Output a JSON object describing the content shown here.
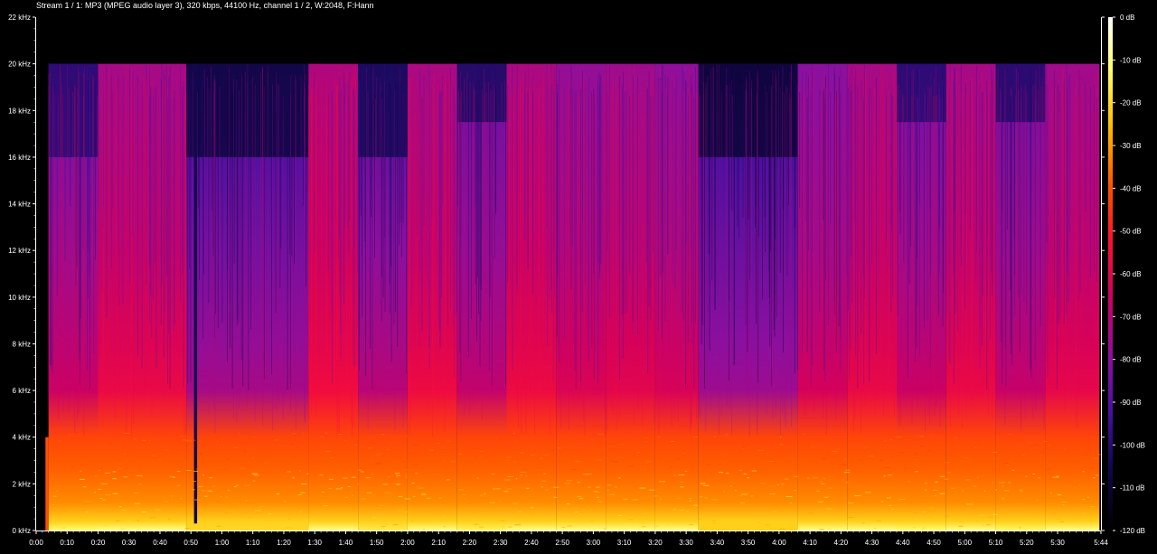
{
  "chart_data": {
    "type": "heatmap",
    "title": "Stream 1 / 1: MP3 (MPEG audio layer 3), 320 kbps, 44100 Hz, channel 1 / 2, W:2048, F:Hann",
    "xlabel": "",
    "ylabel": "",
    "x_unit": "seconds",
    "xlim": [
      0,
      344
    ],
    "ylim_khz": [
      0,
      22
    ],
    "x_ticks": [
      {
        "value": 0,
        "label": "0:00"
      },
      {
        "value": 10,
        "label": "0:10"
      },
      {
        "value": 20,
        "label": "0:20"
      },
      {
        "value": 30,
        "label": "0:30"
      },
      {
        "value": 40,
        "label": "0:40"
      },
      {
        "value": 50,
        "label": "0:50"
      },
      {
        "value": 60,
        "label": "1:00"
      },
      {
        "value": 70,
        "label": "1:10"
      },
      {
        "value": 80,
        "label": "1:20"
      },
      {
        "value": 90,
        "label": "1:30"
      },
      {
        "value": 100,
        "label": "1:40"
      },
      {
        "value": 110,
        "label": "1:50"
      },
      {
        "value": 120,
        "label": "2:00"
      },
      {
        "value": 130,
        "label": "2:10"
      },
      {
        "value": 140,
        "label": "2:20"
      },
      {
        "value": 150,
        "label": "2:30"
      },
      {
        "value": 160,
        "label": "2:40"
      },
      {
        "value": 170,
        "label": "2:50"
      },
      {
        "value": 180,
        "label": "3:00"
      },
      {
        "value": 190,
        "label": "3:10"
      },
      {
        "value": 200,
        "label": "3:20"
      },
      {
        "value": 210,
        "label": "3:30"
      },
      {
        "value": 220,
        "label": "3:40"
      },
      {
        "value": 230,
        "label": "3:50"
      },
      {
        "value": 240,
        "label": "4:00"
      },
      {
        "value": 250,
        "label": "4:10"
      },
      {
        "value": 260,
        "label": "4:20"
      },
      {
        "value": 270,
        "label": "4:30"
      },
      {
        "value": 280,
        "label": "4:40"
      },
      {
        "value": 290,
        "label": "4:50"
      },
      {
        "value": 300,
        "label": "5:00"
      },
      {
        "value": 310,
        "label": "5:10"
      },
      {
        "value": 320,
        "label": "5:20"
      },
      {
        "value": 330,
        "label": "5:30"
      },
      {
        "value": 344,
        "label": "5:44"
      }
    ],
    "y_ticks": [
      {
        "value": 0,
        "label": "0 kHz"
      },
      {
        "value": 2,
        "label": "2 kHz"
      },
      {
        "value": 4,
        "label": "4 kHz"
      },
      {
        "value": 6,
        "label": "6 kHz"
      },
      {
        "value": 8,
        "label": "8 kHz"
      },
      {
        "value": 10,
        "label": "10 kHz"
      },
      {
        "value": 12,
        "label": "12 kHz"
      },
      {
        "value": 14,
        "label": "14 kHz"
      },
      {
        "value": 16,
        "label": "16 kHz"
      },
      {
        "value": 18,
        "label": "18 kHz"
      },
      {
        "value": 20,
        "label": "20 kHz"
      },
      {
        "value": 22,
        "label": "22 kHz"
      }
    ],
    "colorbar": {
      "range_db": [
        -120,
        0
      ],
      "ticks": [
        {
          "value": 0,
          "label": "0 dB"
        },
        {
          "value": -10,
          "label": "-10 dB"
        },
        {
          "value": -20,
          "label": "-20 dB"
        },
        {
          "value": -30,
          "label": "-30 dB"
        },
        {
          "value": -40,
          "label": "-40 dB"
        },
        {
          "value": -50,
          "label": "-50 dB"
        },
        {
          "value": -60,
          "label": "-60 dB"
        },
        {
          "value": -70,
          "label": "-70 dB"
        },
        {
          "value": -80,
          "label": "-80 dB"
        },
        {
          "value": -90,
          "label": "-90 dB"
        },
        {
          "value": -100,
          "label": "-100 dB"
        },
        {
          "value": -110,
          "label": "-110 dB"
        },
        {
          "value": -120,
          "label": "-120 dB"
        }
      ],
      "stops": [
        {
          "db": 0,
          "color": "#ffffff"
        },
        {
          "db": -12,
          "color": "#ffff70"
        },
        {
          "db": -25,
          "color": "#ffc000"
        },
        {
          "db": -40,
          "color": "#ff5000"
        },
        {
          "db": -52,
          "color": "#ff1030"
        },
        {
          "db": -65,
          "color": "#d00060"
        },
        {
          "db": -80,
          "color": "#8a10a0"
        },
        {
          "db": -92,
          "color": "#4a10a0"
        },
        {
          "db": -105,
          "color": "#100850"
        },
        {
          "db": -120,
          "color": "#000000"
        }
      ]
    },
    "lowpass_cutoff_khz": 20,
    "segments": [
      {
        "start": 4,
        "end": 20,
        "level_db": -72,
        "upper_cutoff_khz": 16
      },
      {
        "start": 20,
        "end": 48.5,
        "level_db": -64,
        "upper_cutoff_khz": 20
      },
      {
        "start": 48.5,
        "end": 88,
        "level_db": -80,
        "upper_cutoff_khz": 16
      },
      {
        "start": 88,
        "end": 104,
        "level_db": -62,
        "upper_cutoff_khz": 20
      },
      {
        "start": 104,
        "end": 120,
        "level_db": -76,
        "upper_cutoff_khz": 16
      },
      {
        "start": 120,
        "end": 136,
        "level_db": -63,
        "upper_cutoff_khz": 20
      },
      {
        "start": 136,
        "end": 152,
        "level_db": -74,
        "upper_cutoff_khz": 17.5
      },
      {
        "start": 152,
        "end": 168,
        "level_db": -63,
        "upper_cutoff_khz": 20
      },
      {
        "start": 168,
        "end": 184,
        "level_db": -68,
        "upper_cutoff_khz": 20
      },
      {
        "start": 184,
        "end": 200,
        "level_db": -66,
        "upper_cutoff_khz": 20
      },
      {
        "start": 200,
        "end": 214,
        "level_db": -69,
        "upper_cutoff_khz": 20
      },
      {
        "start": 214,
        "end": 246,
        "level_db": -82,
        "upper_cutoff_khz": 16
      },
      {
        "start": 246,
        "end": 262,
        "level_db": -70,
        "upper_cutoff_khz": 20
      },
      {
        "start": 262,
        "end": 278,
        "level_db": -64,
        "upper_cutoff_khz": 20
      },
      {
        "start": 278,
        "end": 294,
        "level_db": -72,
        "upper_cutoff_khz": 17.5
      },
      {
        "start": 294,
        "end": 310,
        "level_db": -64,
        "upper_cutoff_khz": 20
      },
      {
        "start": 310,
        "end": 326,
        "level_db": -73,
        "upper_cutoff_khz": 17.5
      },
      {
        "start": 326,
        "end": 343.5,
        "level_db": -65,
        "upper_cutoff_khz": 20
      }
    ],
    "bright_bands": [
      {
        "low_khz": 0,
        "high_khz": 0.4,
        "level_db": -10
      },
      {
        "low_khz": 0.4,
        "high_khz": 2.6,
        "level_db": -32
      },
      {
        "low_khz": 2.6,
        "high_khz": 4,
        "level_db": -42
      }
    ],
    "dropouts": [
      {
        "start": 51,
        "end": 52,
        "level_db": -105
      }
    ]
  }
}
